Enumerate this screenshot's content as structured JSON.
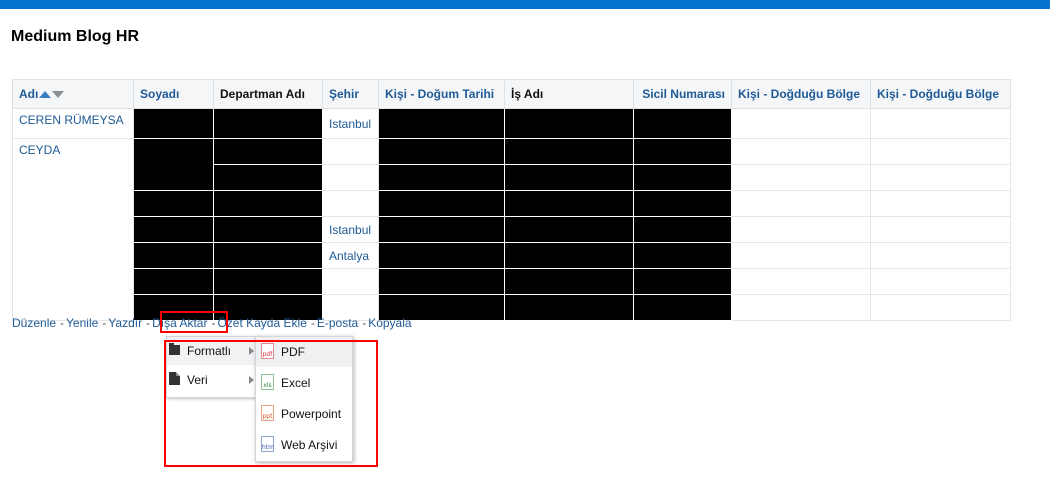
{
  "page_title": "Medium Blog HR",
  "table": {
    "columns": [
      "Adı",
      "Soyadı",
      "Departman Adı",
      "Şehir",
      "Kişi - Doğum Tarihi",
      "İş Adı",
      "Sicil Numarası",
      "Kişi - Doğduğu Bölge",
      "Kişi - Doğduğu Bölge"
    ],
    "names": [
      "CEREN RÜMEYSA",
      "CEYDA"
    ],
    "cities": [
      "Istanbul",
      "Istanbul",
      "Antalya"
    ]
  },
  "links": [
    "Düzenle",
    "Yenile",
    "Yazdır",
    "Dışa Aktar",
    "Özet Kayda Ekle",
    "E-posta",
    "Kopyala"
  ],
  "link_separator": "-",
  "export_menu": {
    "items": [
      {
        "label": "Formatlı",
        "icon": "folder-icon"
      },
      {
        "label": "Veri",
        "icon": "document-icon"
      }
    ]
  },
  "format_menu": {
    "items": [
      {
        "label": "PDF",
        "icon_text": "pdf"
      },
      {
        "label": "Excel",
        "icon_text": "xls"
      },
      {
        "label": "Powerpoint",
        "icon_text": "ppt"
      },
      {
        "label": "Web Arşivi",
        "icon_text": "htm"
      }
    ]
  },
  "colors": {
    "topbar": "#0572ce",
    "link": "#1f5a96",
    "highlight": "#ff0000",
    "redacted": "#000000"
  }
}
